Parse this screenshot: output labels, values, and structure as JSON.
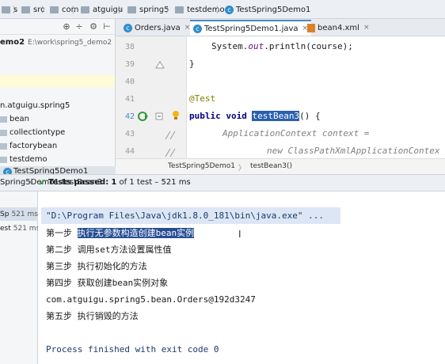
{
  "breadcrumb": {
    "items": [
      {
        "label": "s",
        "icon": "folder-icon"
      },
      {
        "label": "src",
        "icon": "folder-icon"
      },
      {
        "label": "com",
        "icon": "folder-icon"
      },
      {
        "label": "atguigu",
        "icon": "folder-icon"
      },
      {
        "label": "spring5",
        "icon": "folder-icon"
      },
      {
        "label": "testdemo",
        "icon": "folder-icon"
      },
      {
        "label": "TestSpring5Demo1",
        "icon": "class-icon"
      }
    ],
    "separator": "〉"
  },
  "project": {
    "root_label": "emo2",
    "root_path": "E:\\work\\spring5_demo2",
    "items": [
      {
        "label": "n.atguigu.spring5"
      },
      {
        "label": "bean"
      },
      {
        "label": "collectiontype"
      },
      {
        "label": "factorybean"
      },
      {
        "label": "testdemo"
      },
      {
        "label": "TestSpring5Demo1"
      }
    ]
  },
  "tabs": [
    {
      "label": "Orders.java",
      "close": "×"
    },
    {
      "label": "TestSpring5Demo1.java",
      "close": "×"
    },
    {
      "label": "bean4.xml",
      "close": "×"
    }
  ],
  "editor": {
    "line_numbers": [
      "38",
      "39",
      "40",
      "41",
      "42",
      "43",
      "44"
    ],
    "lines": {
      "l38_prefix": "System.",
      "l38_field": "out",
      "l38_suffix": ".println(course);",
      "l39": "}",
      "l41": "@Test",
      "l42_kw": "public void",
      "l42_method": "testBean3",
      "l42_suffix": "() {",
      "l43": "ApplicationContext context =",
      "l44": "new ClassPathXmlApplicationContex"
    },
    "breadcrumb": {
      "class": "TestSpring5Demo1",
      "method": "testBean3()",
      "separator": "〉"
    }
  },
  "run": {
    "tab_label": "TestSpring5Demo1",
    "config": "Spring5Demo1.testBean3",
    "status_prefix": "Tests passed:",
    "status_count": "1",
    "status_suffix": "of 1 test – 521 ms",
    "tree": [
      {
        "label": "Sp",
        "time": "521 ms"
      },
      {
        "label": "est",
        "time": "521 ms"
      }
    ],
    "console": {
      "cmd": "\"D:\\Program Files\\Java\\jdk1.8.0_181\\bin\\java.exe\" ...",
      "step1_label": "第一步",
      "step1_text": "执行无参数构造创建bean实例",
      "step2": "第二步 调用set方法设置属性值",
      "step3": "第三步 执行初始化的方法",
      "step4": "第四步 获取创建bean实例对象",
      "object": "com.atguigu.spring5.bean.Orders@192d3247",
      "step5": "第五步 执行销毁的方法",
      "exit": "Process finished with exit code 0"
    }
  },
  "colors": {
    "accent": "#4a88c7",
    "selection": "#274e93",
    "pass": "#2f9a3a"
  }
}
